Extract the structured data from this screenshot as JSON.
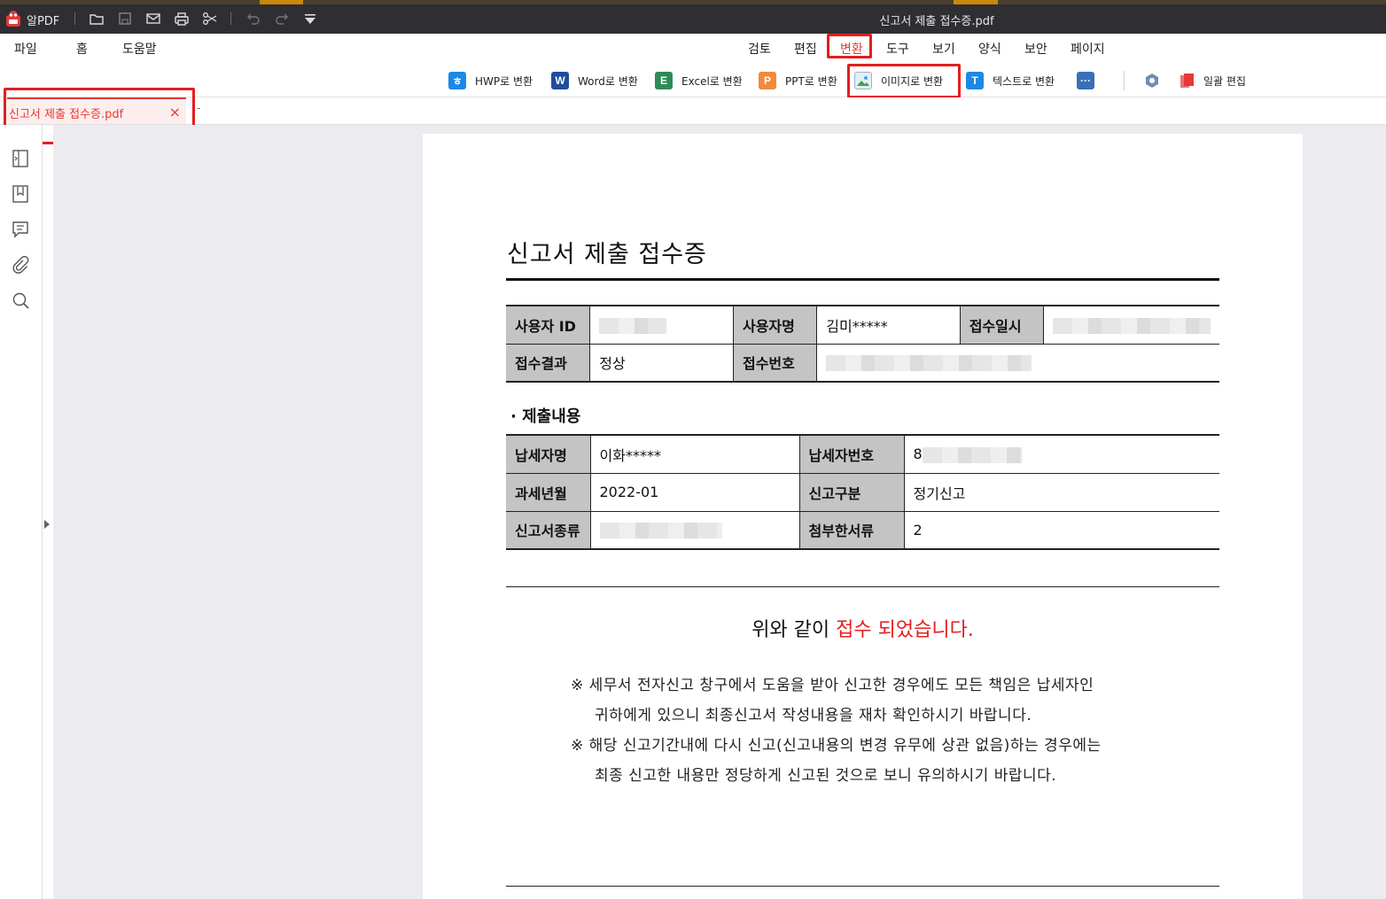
{
  "app": {
    "name": "알PDF",
    "document_title": "신고서 제출 접수증.pdf"
  },
  "menu": {
    "file": "파일",
    "home": "홈",
    "help": "도움말"
  },
  "ribbon_tabs": [
    "검토",
    "편집",
    "변환",
    "도구",
    "보기",
    "양식",
    "보안",
    "페이지"
  ],
  "active_ribbon_tab": "변환",
  "tools": {
    "hwp": "HWP로 변환",
    "word": "Word로 변환",
    "excel": "Excel로 변환",
    "ppt": "PPT로 변환",
    "image": "이미지로 변환",
    "text": "텍스트로 변환",
    "batch": "일괄 편집"
  },
  "tab": {
    "label": "신고서 제출 접수증.pdf",
    "close": "×",
    "dash": "-"
  },
  "colors": {
    "highlight": "#e41e1e",
    "accent": "#e53935",
    "titlebar": "#2e2e33",
    "header_cell": "#c4c4c4"
  },
  "document": {
    "title": "신고서 제출 접수증",
    "table1": {
      "user_id_label": "사용자 ID",
      "user_name_label": "사용자명",
      "user_name_value": "김미*****",
      "received_at_label": "접수일시",
      "result_label": "접수결과",
      "result_value": "정상",
      "receipt_no_label": "접수번호"
    },
    "section_title": "· 제출내용",
    "table2": {
      "taxpayer_label": "납세자명",
      "taxpayer_value": "이화*****",
      "taxpayer_no_label": "납세자번호",
      "taxpayer_no_value": "8",
      "period_label": "과세년월",
      "period_value": "2022-01",
      "report_type_label": "신고구분",
      "report_type_value": "정기신고",
      "form_type_label": "신고서종류",
      "attachments_label": "첨부한서류",
      "attachments_value": "2"
    },
    "notice_prefix": "위와 같이 ",
    "notice_red": "접수 되었습니다.",
    "notes": [
      "※ 세무서 전자신고 창구에서 도움을 받아 신고한 경우에도 모든 책임은 납세자인",
      "귀하에게 있으니 최종신고서 작성내용을 재차 확인하시기 바랍니다.",
      "※ 해당 신고기간내에 다시 신고(신고내용의 변경 유무에 상관 없음)하는 경우에는",
      "최종 신고한 내용만 정당하게 신고된 것으로 보니 유의하시기 바랍니다."
    ]
  }
}
